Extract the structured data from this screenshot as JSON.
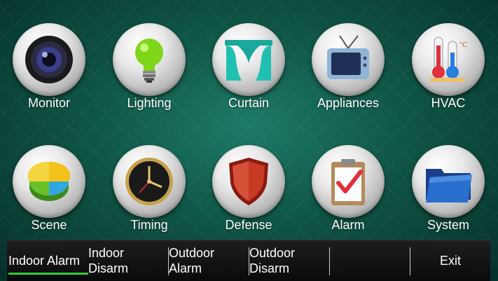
{
  "tiles": [
    {
      "label": "Monitor",
      "icon": "camera-lens-icon"
    },
    {
      "label": "Lighting",
      "icon": "light-bulb-icon"
    },
    {
      "label": "Curtain",
      "icon": "curtain-icon"
    },
    {
      "label": "Appliances",
      "icon": "tv-icon"
    },
    {
      "label": "HVAC",
      "icon": "thermometer-icon"
    },
    {
      "label": "Scene",
      "icon": "pie-chart-icon"
    },
    {
      "label": "Timing",
      "icon": "clock-icon"
    },
    {
      "label": "Defense",
      "icon": "shield-icon"
    },
    {
      "label": "Alarm",
      "icon": "clipboard-check-icon"
    },
    {
      "label": "System",
      "icon": "folder-icon"
    }
  ],
  "hvac_unit": "°C",
  "bottom_bar": {
    "tabs": [
      {
        "label": "Indoor Alarm"
      },
      {
        "label": "Indoor\nDisarm"
      },
      {
        "label": "Outdoor\nAlarm"
      },
      {
        "label": "Outdoor\nDisarm"
      },
      {
        "label": ""
      },
      {
        "label": "Exit"
      }
    ],
    "active_color": "#2ecc40"
  }
}
